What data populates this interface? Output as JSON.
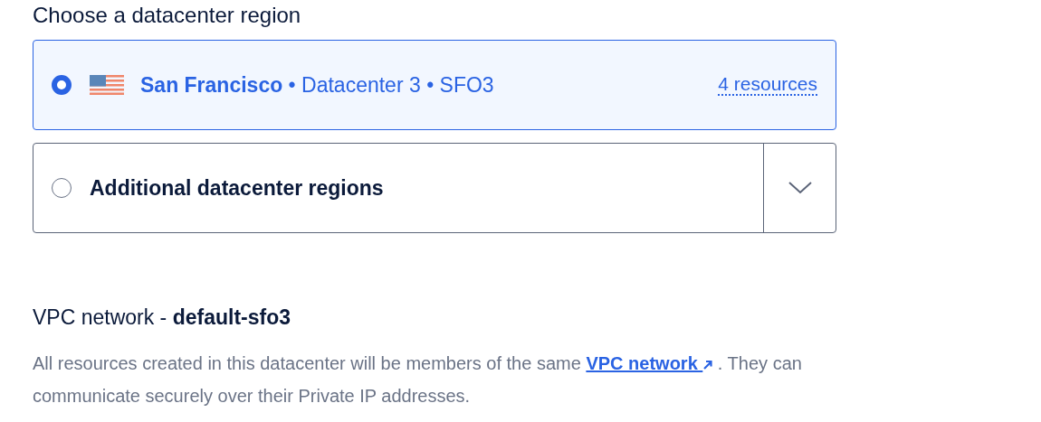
{
  "heading": "Choose a datacenter region",
  "regions": [
    {
      "kind": "region",
      "label": "**San Francisco** • Datacenter 3 • SFO3",
      "resources": "4 resources",
      "selected": true
    },
    {
      "kind": "more",
      "label": "Additional datacenter regions",
      "selected": false
    }
  ],
  "vpc": {
    "title": "VPC network - **default-sfo3**",
    "text_before": "All resources created in this datacenter will be members of the same",
    "link": "VPC network",
    "text_after": ". They can communicate securely over their Private IP addresses."
  }
}
